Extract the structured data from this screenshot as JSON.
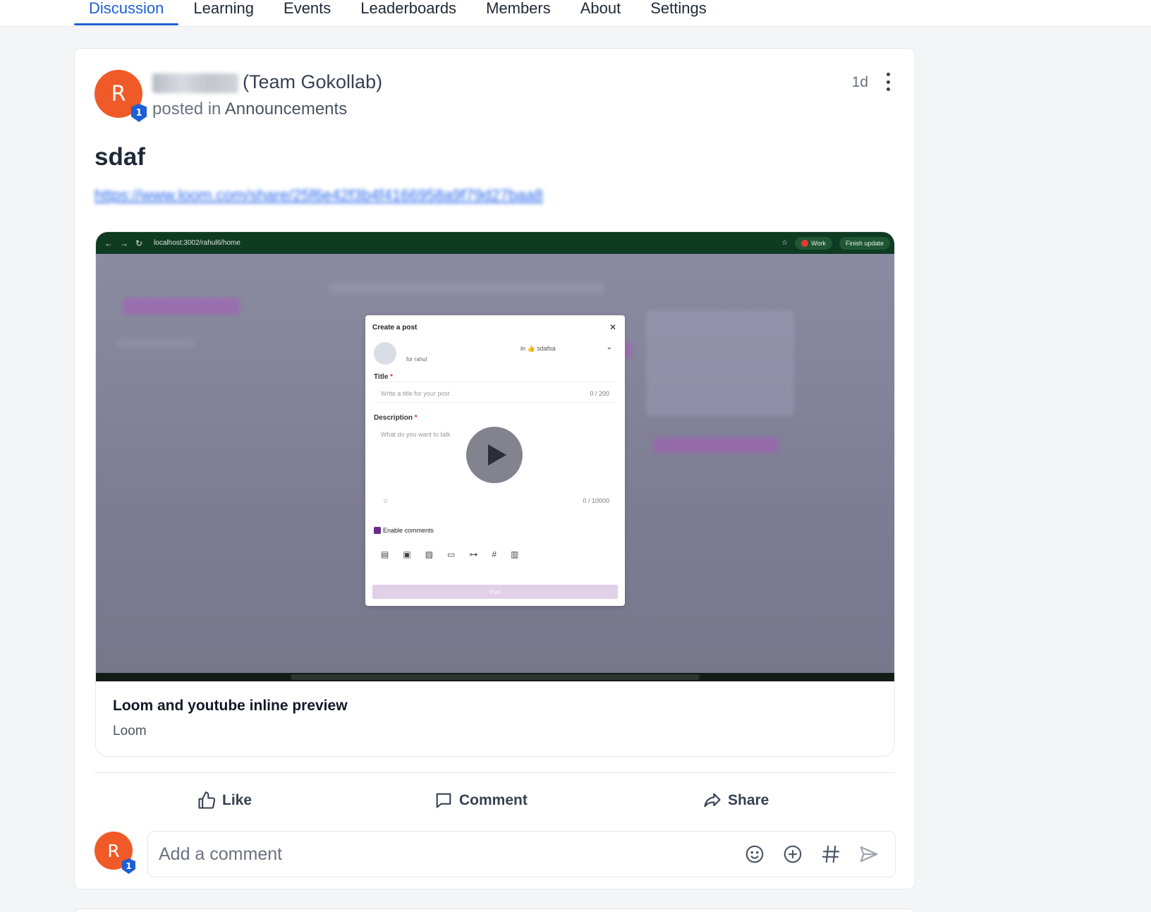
{
  "nav": {
    "tabs": [
      "Discussion",
      "Learning",
      "Events",
      "Leaderboards",
      "Members",
      "About",
      "Settings"
    ],
    "active_tab": "Discussion"
  },
  "post": {
    "author_initial": "R",
    "author_badge": "1",
    "author_team": "(Team Gokollab)",
    "posted_in_prefix": "posted in",
    "space": "Announcements",
    "time": "1d",
    "title": "sdaf",
    "link": "https://www.loom.com/share/25f6e42f3b4f4166958a9f79d27baa8"
  },
  "embed": {
    "title": "Loom and youtube inline preview",
    "source": "Loom",
    "video": {
      "url_bar": "localhost:3002/rahul6/home",
      "work_pill": "Work",
      "finish_pill": "Finish update",
      "modal_title": "Create a post",
      "modal_for": "for rahul",
      "modal_in": "in 👍 sdafsa",
      "title_label": "Title",
      "title_placeholder": "Write a title for your post",
      "title_count": "0 / 200",
      "description_label": "Description",
      "description_placeholder": "What do you want to talk",
      "description_count": "0 / 10000",
      "enable_comments": "Enable comments",
      "post_button": "Post"
    }
  },
  "actions": {
    "like": "Like",
    "comment": "Comment",
    "share": "Share"
  },
  "comment": {
    "avatar_initial": "R",
    "avatar_badge": "1",
    "placeholder": "Add a comment"
  },
  "colors": {
    "accent": "#1d5fd6",
    "avatar": "#f05a28"
  }
}
